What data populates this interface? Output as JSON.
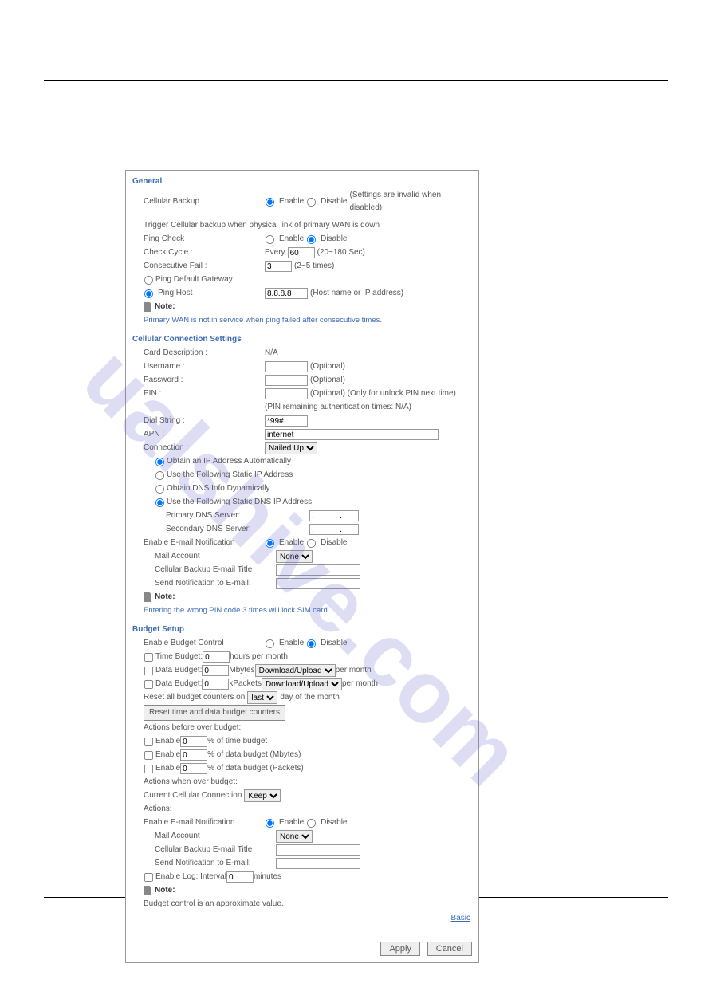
{
  "watermark": "ualshive.com",
  "general": {
    "title": "General",
    "cellular_backup_label": "Cellular Backup",
    "enable": "Enable",
    "disable": "Disable",
    "disable_note": "(Settings are invalid when disabled)",
    "trigger_text": "Trigger Cellular backup when physical link of primary WAN is down",
    "ping_check_label": "Ping Check",
    "check_cycle_label": "Check Cycle :",
    "every": "Every",
    "cycle_value": "60",
    "cycle_range": "(20~180 Sec)",
    "consecutive_fail_label": "Consecutive Fail :",
    "fail_value": "3",
    "fail_range": "(2~5 times)",
    "ping_gateway": "Ping Default Gateway",
    "ping_host": "Ping Host",
    "ping_host_value": "8.8.8.8",
    "ping_host_hint": "(Host name or IP address)",
    "note_label": "Note:",
    "note_text": "Primary WAN is not in service when ping failed after consecutive times."
  },
  "cellular": {
    "title": "Cellular Connection Settings",
    "card_desc_label": "Card Description :",
    "card_desc_value": "N/A",
    "username_label": "Username :",
    "password_label": "Password :",
    "pin_label": "PIN :",
    "optional": "(Optional)",
    "pin_optional": "(Optional) (Only for unlock PIN next time)",
    "pin_remain": "(PIN remaining authentication times: N/A)",
    "dial_label": "Dial String :",
    "dial_value": "*99#",
    "apn_label": "APN :",
    "apn_value": "internet",
    "connection_label": "Connection :",
    "connection_value": "Nailed Up",
    "ip_auto": "Obtain an IP Address Automatically",
    "ip_static": "Use the Following Static IP Address",
    "dns_auto": "Obtain DNS Info Dynamically",
    "dns_static": "Use the Following Static DNS IP Address",
    "primary_dns": "Primary DNS Server:",
    "secondary_dns": "Secondary DNS Server:",
    "dot_value": ".   .   .",
    "email_notif_label": "Enable E-mail Notification",
    "mail_account_label": "Mail Account",
    "mail_account_value": "None",
    "email_title_label": "Cellular Backup E-mail Title",
    "send_to_label": "Send Notification to E-mail:",
    "note_label": "Note:",
    "note_text": "Entering the wrong PIN code 3 times will lock SIM card."
  },
  "budget": {
    "title": "Budget Setup",
    "enable_budget_label": "Enable Budget Control",
    "time_budget_label": "Time Budget:",
    "zero": "0",
    "hours_per_month": "hours per month",
    "data_budget_label": "Data Budget:",
    "mbytes": "Mbytes",
    "kpackets": "kPackets",
    "download_upload": "Download/Upload",
    "per_month": "per month",
    "reset_counters_label": "Reset all budget counters on",
    "last": "last",
    "day_of_month": "day of the month",
    "reset_btn": "Reset time and data budget counters",
    "actions_before": "Actions before over budget:",
    "enable_word": "Enable",
    "pct_time": "% of time budget",
    "pct_data_mb": "% of data budget (Mbytes)",
    "pct_data_pk": "% of data budget (Packets)",
    "actions_over": "Actions when over budget:",
    "current_conn": "Current Cellular Connection",
    "keep": "Keep",
    "actions_label": "Actions:",
    "email_notif_label": "Enable E-mail Notification",
    "mail_account_label": "Mail Account",
    "mail_account_value": "None",
    "email_title_label": "Cellular Backup E-mail Title",
    "send_to_label": "Send Notification to E-mail:",
    "enable_log": "Enable Log: Interval",
    "minutes": "minutes",
    "note_label": "Note:",
    "note_text": "Budget control is an approximate value.",
    "basic_link": "Basic",
    "apply": "Apply",
    "cancel": "Cancel"
  }
}
